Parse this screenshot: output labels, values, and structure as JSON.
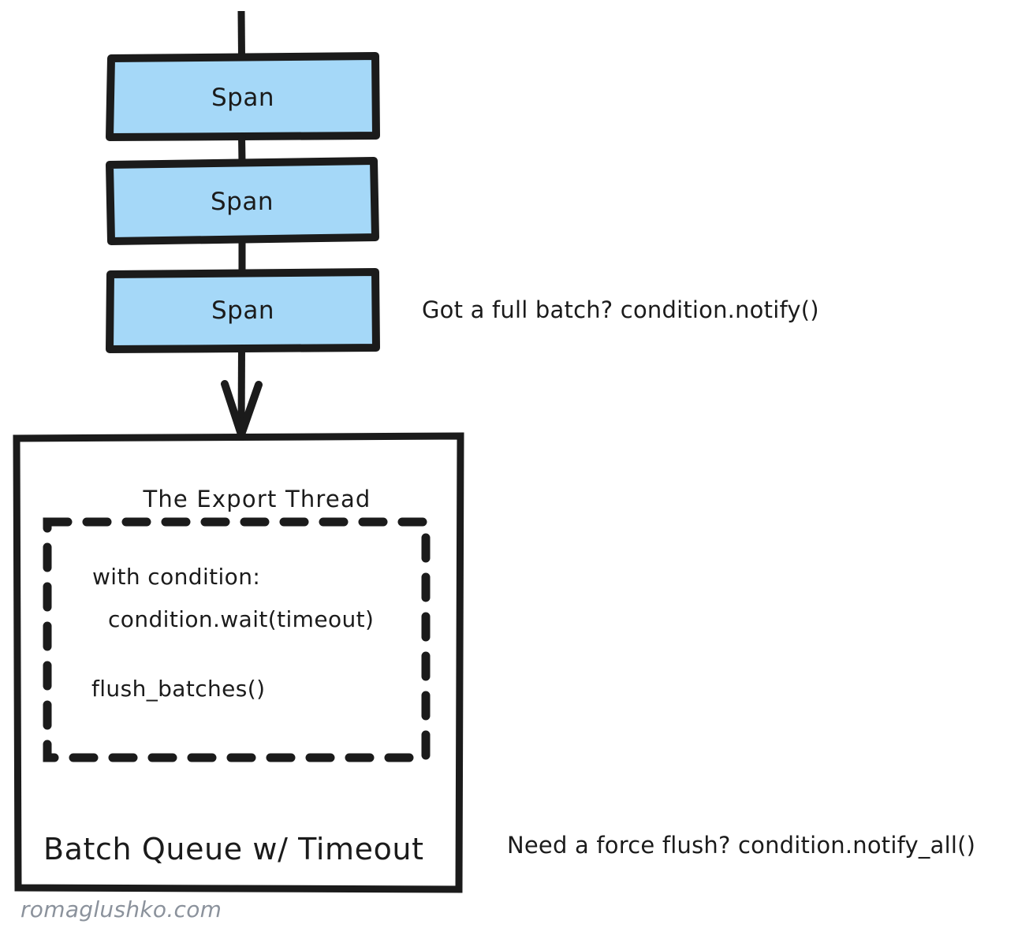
{
  "diagram": {
    "title_watermark": "romaglushko.com",
    "pipeline": {
      "spans": [
        {
          "label": "Span"
        },
        {
          "label": "Span"
        },
        {
          "label": "Span"
        }
      ]
    },
    "queue_box": {
      "thread_title": "The Export Thread",
      "code_lines": [
        "with condition:",
        "condition.wait(timeout)",
        "flush_batches()"
      ],
      "caption": "Batch Queue w/ Timeout"
    },
    "annotations": [
      {
        "text": "Got a full batch? condition.notify()"
      },
      {
        "text": "Need a force flush? condition.notify_all()"
      }
    ],
    "colors": {
      "span_fill": "#a5d8f8",
      "stroke": "#1b1b1b",
      "background": "#ffffff",
      "watermark": "#8b929c"
    }
  }
}
